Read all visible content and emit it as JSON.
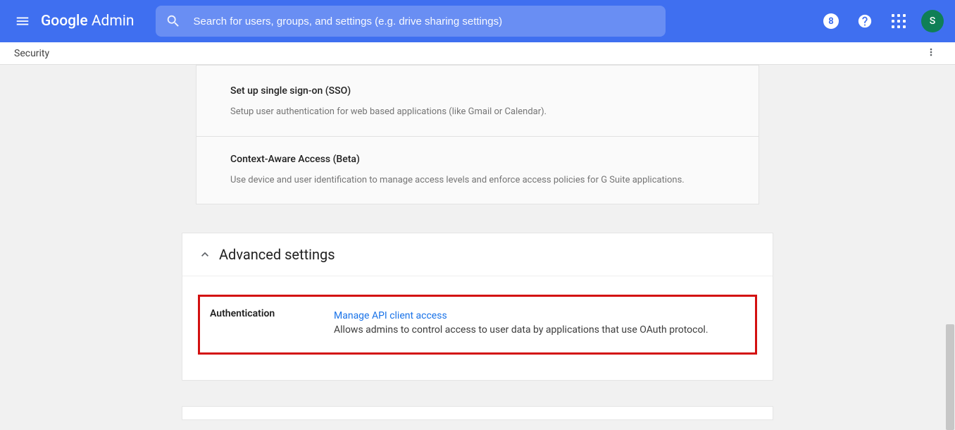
{
  "header": {
    "logo_google": "Google",
    "logo_admin": " Admin",
    "search_placeholder": "Search for users, groups, and settings (e.g. drive sharing settings)",
    "avatar_letter": "S"
  },
  "subheader": {
    "breadcrumb": "Security"
  },
  "cards": {
    "sso": {
      "title": "Set up single sign-on (SSO)",
      "desc": "Setup user authentication for web based applications (like Gmail or Calendar)."
    },
    "caa": {
      "title": "Context-Aware Access (Beta)",
      "desc": "Use device and user identification to manage access levels and enforce access policies for G Suite applications."
    }
  },
  "advanced": {
    "header": "Advanced settings",
    "auth_label": "Authentication",
    "link_text": "Manage API client access",
    "link_desc": "Allows admins to control access to user data by applications that use OAuth protocol."
  }
}
